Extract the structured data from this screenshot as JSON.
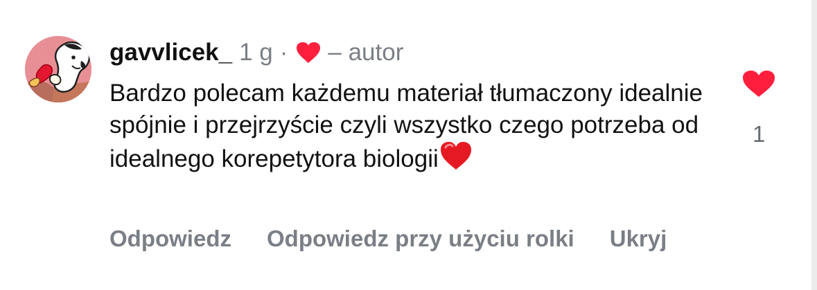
{
  "comment": {
    "username": "gavvlicek_",
    "time": "1 g",
    "separator": "·",
    "author_label": "– autor",
    "text": "Bardzo polecam każdemu materiał tłumaczony idealnie spójnie i przejrzyście czyli wszystko czego potrzeba od idealnego korepetytora biologii",
    "emoji": "heart-emoji-icon",
    "like_count": "1"
  },
  "actions": {
    "reply": "Odpowiedz",
    "reply_reel": "Odpowiedz przy użyciu rolki",
    "hide": "Ukryj"
  },
  "icons": {
    "author_heart": "heart-icon",
    "like": "heart-icon"
  },
  "colors": {
    "heart": "#ff1f3d",
    "emoji_heart": "#e51923",
    "secondary_text": "#7a7f86",
    "primary_text": "#111111"
  }
}
